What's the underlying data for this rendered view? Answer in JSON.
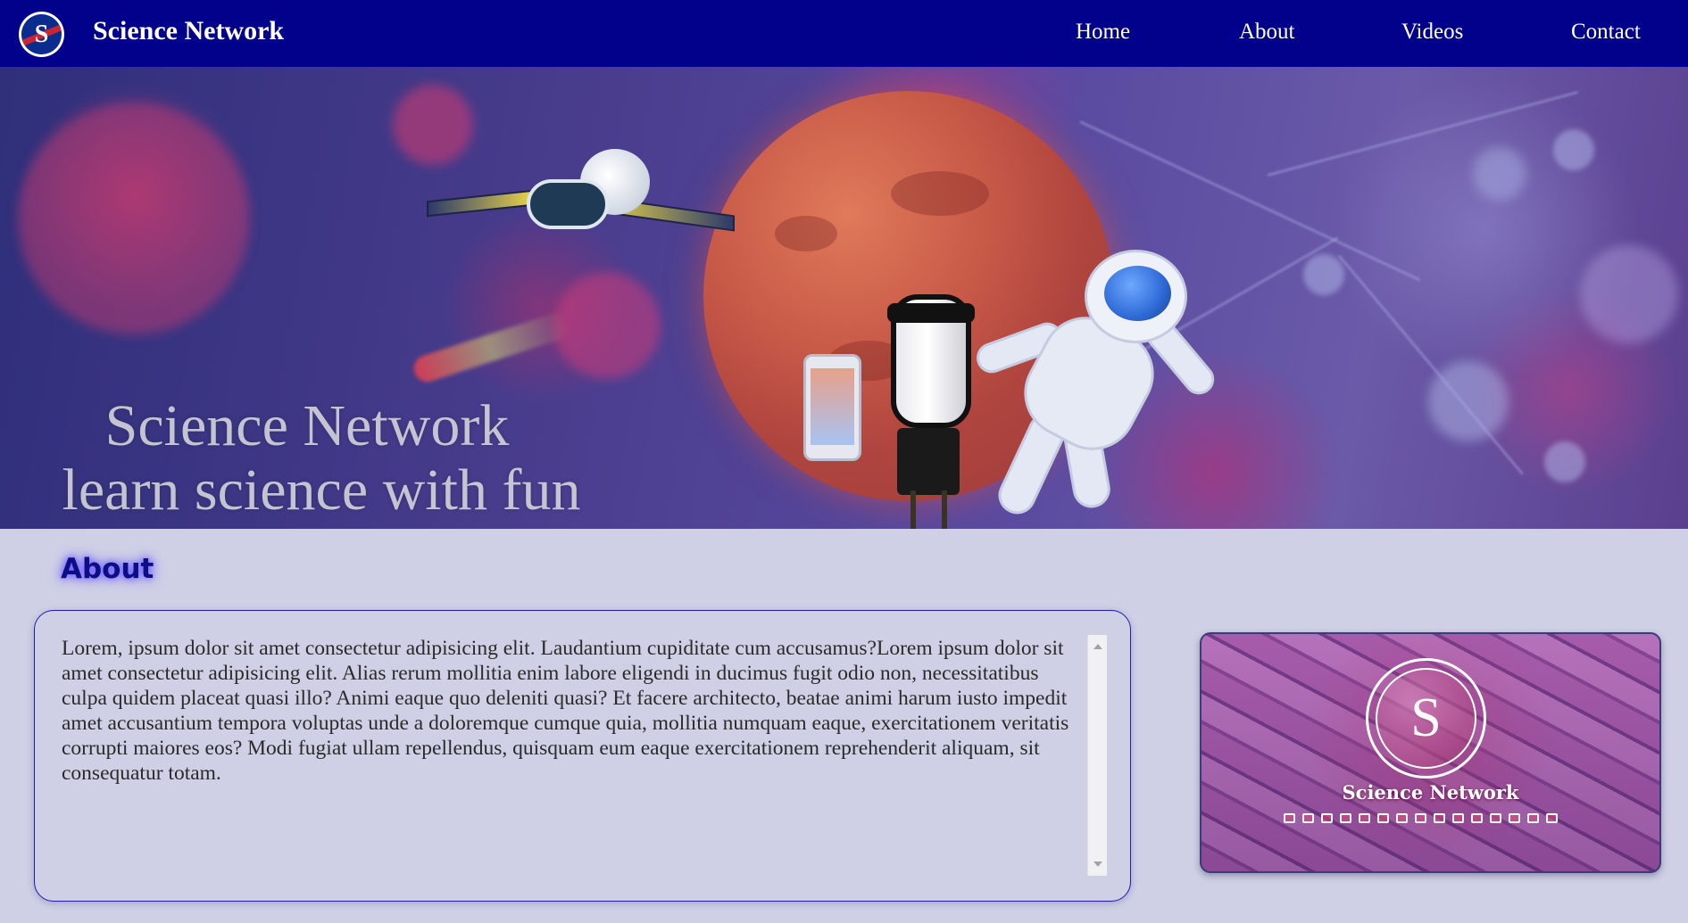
{
  "navbar": {
    "brand": "Science Network",
    "logo_icon": "science-network-logo",
    "background": "#01018c",
    "links": [
      "Home",
      "About",
      "Videos",
      "Contact"
    ]
  },
  "hero": {
    "title": "Science Network",
    "subtitle": "learn science with fun"
  },
  "about": {
    "heading": "About",
    "text": "Lorem, ipsum dolor sit amet consectetur adipisicing elit. Laudantium cupiditate cum accusamus?Lorem ipsum dolor sit amet consectetur adipisicing elit. Alias rerum mollitia enim labore eligendi in ducimus fugit odio non, necessitatibus culpa quidem placeat quasi illo? Animi eaque quo deleniti quasi? Et facere architecto, beatae animi harum iusto impedit amet accusantium tempora voluptas unde a doloremque cumque quia, mollitia numquam eaque, exercitationem veritatis corrupti maiores eos? Modi fugiat ullam repellendus, quisquam eum eaque exercitationem reprehenderit aliquam, sit consequatur totam."
  },
  "video_card": {
    "logo_letter": "S",
    "title": "Science Network"
  },
  "colors": {
    "page_bg": "#cfcfe6",
    "heading": "#0d0d85",
    "accent_border": "#1e1ea8"
  }
}
